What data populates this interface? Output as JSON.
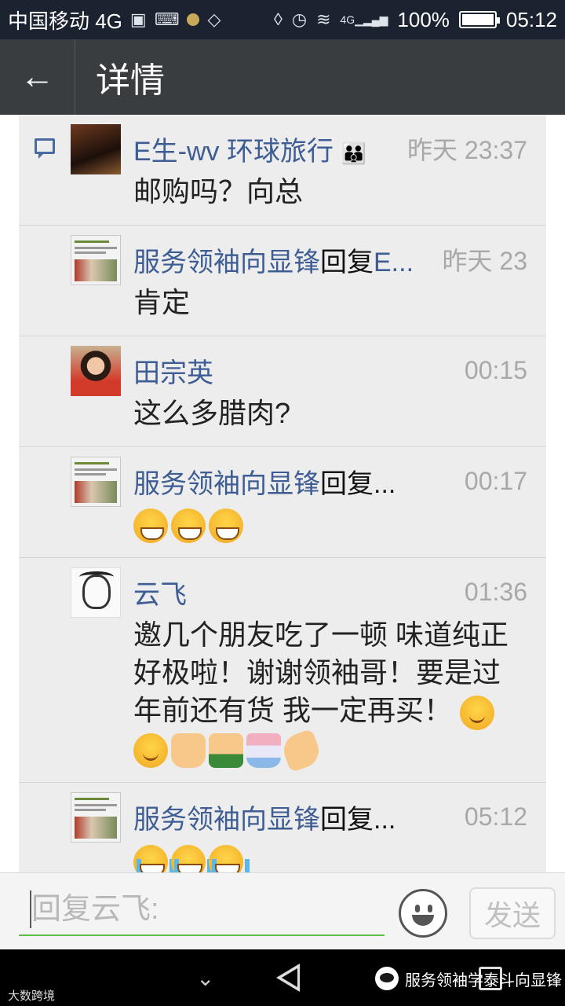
{
  "status_bar": {
    "carrier": "中国移动 4G",
    "network_label": "4G",
    "battery": "100%",
    "time": "05:12"
  },
  "header": {
    "title": "详情",
    "back_icon": "arrow-left-icon"
  },
  "comments": [
    {
      "name": "E生-wv 环球旅行",
      "reply_word": "",
      "reply_target": "",
      "time": "昨天 23:37",
      "text": "邮购吗？向总",
      "emojis": []
    },
    {
      "name": "服务领袖向显锋",
      "reply_word": "回复",
      "reply_target": "E...",
      "time": "昨天 23",
      "text": "肯定",
      "emojis": []
    },
    {
      "name": "田宗英",
      "reply_word": "",
      "reply_target": "",
      "time": "00:15",
      "text": "这么多腊肉?",
      "emojis": []
    },
    {
      "name": "服务领袖向显锋",
      "reply_word": "回复...",
      "reply_target": "",
      "time": "00:17",
      "text": "",
      "emojis": [
        "grin",
        "grin",
        "grin"
      ]
    },
    {
      "name": "云飞",
      "reply_word": "",
      "reply_target": "",
      "time": "01:36",
      "text": "邀几个朋友吃了一顿 味道纯正 好极啦！谢谢领袖哥！要是过年前还有货 我一定再买！",
      "emojis": [
        "chuckle",
        "chuckle",
        "victory",
        "thumbs",
        "cup",
        "ok"
      ]
    },
    {
      "name": "服务领袖向显锋",
      "reply_word": "回复...",
      "reply_target": "",
      "time": "05:12",
      "text": "",
      "emojis": [
        "cry",
        "cry",
        "cry"
      ]
    }
  ],
  "reply_bar": {
    "placeholder": "回复云飞:",
    "send_label": "发送"
  },
  "watermark": {
    "left": "大数跨境",
    "right": "服务领袖学泰斗向显锋"
  }
}
